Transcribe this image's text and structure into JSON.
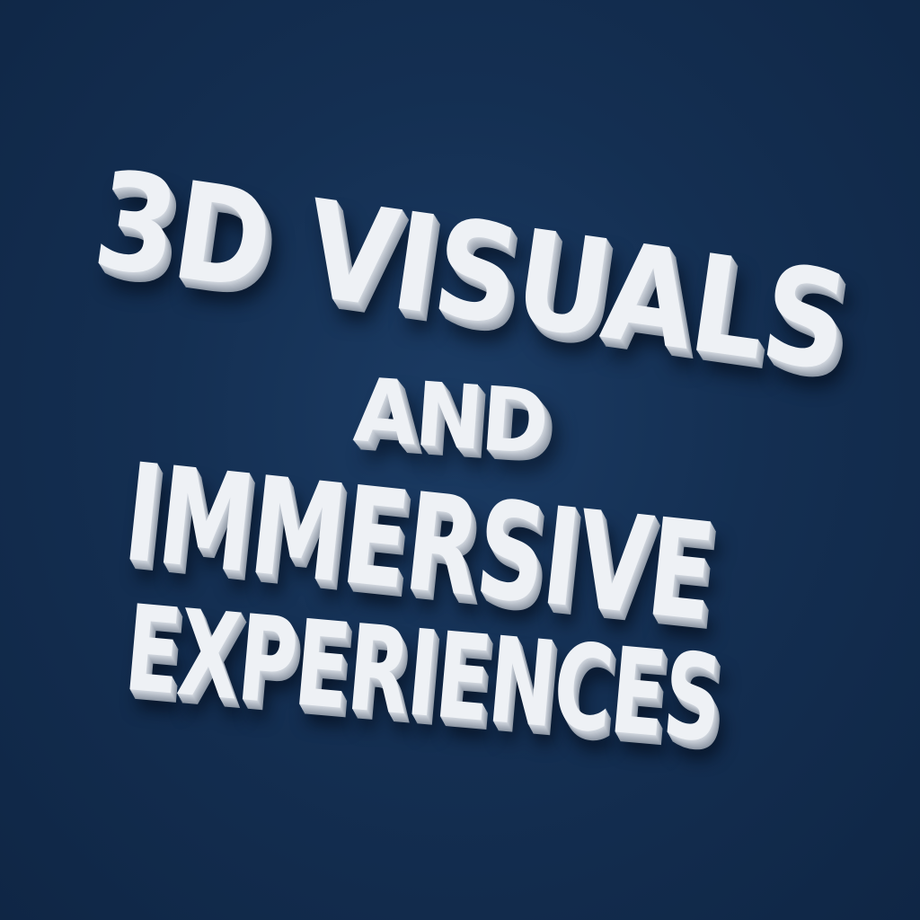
{
  "background_color": "#142f52",
  "text_color": "#eef1f5",
  "headline": {
    "line1": "3D VISUALS",
    "line2": "AND",
    "line3": "IMMERSIVE",
    "line4": "EXPERIENCES"
  }
}
